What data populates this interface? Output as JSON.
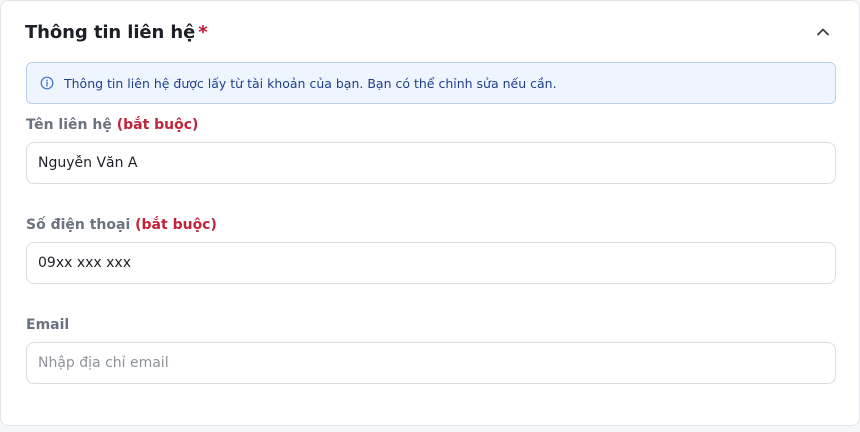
{
  "section": {
    "title": "Thông tin liên hệ",
    "required_marker": "*",
    "collapse_icon": "chevron-up-icon"
  },
  "info_banner": {
    "icon": "info-icon",
    "text": "Thông tin liên hệ được lấy từ tài khoản của bạn. Bạn có thể chỉnh sửa nếu cần."
  },
  "fields": {
    "contact_name": {
      "label": "Tên liên hệ",
      "required_text": "(bắt buộc)",
      "value": "Nguyễn Văn A",
      "placeholder": ""
    },
    "phone": {
      "label": "Số điện thoại",
      "required_text": "(bắt buộc)",
      "value": "09xx xxx xxx",
      "placeholder": ""
    },
    "email": {
      "label": "Email",
      "value": "",
      "placeholder": "Nhập địa chỉ email"
    }
  },
  "colors": {
    "required": "#c0243a",
    "info_bg": "#eef5ff",
    "info_border": "#b9d1ef",
    "info_text": "#1f3f8a"
  }
}
